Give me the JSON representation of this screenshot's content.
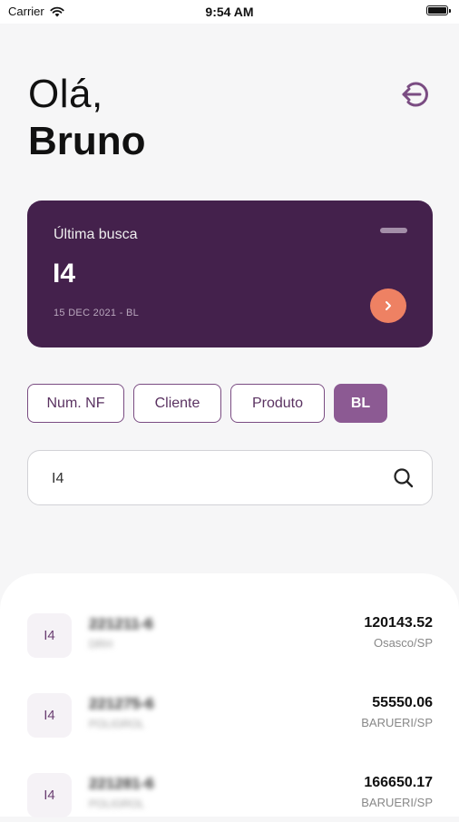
{
  "status_bar": {
    "carrier": "Carrier",
    "time": "9:54 AM"
  },
  "greeting": {
    "hello": "Olá,",
    "name": "Bruno"
  },
  "last_search": {
    "label": "Última busca",
    "value": "I4",
    "meta": "15 DEC 2021 - BL",
    "go_icon": "chevron-right"
  },
  "filters": [
    {
      "label": "Num. NF",
      "active": false
    },
    {
      "label": "Cliente",
      "active": false
    },
    {
      "label": "Produto",
      "active": false
    },
    {
      "label": "BL",
      "active": true
    }
  ],
  "search": {
    "value": "I4",
    "icon": "search"
  },
  "results": [
    {
      "badge": "I4",
      "title": "221211-6",
      "subtitle": "DRH",
      "amount": "120143.52",
      "city": "Osasco/SP"
    },
    {
      "badge": "I4",
      "title": "221275-6",
      "subtitle": "POLIGROL",
      "amount": "55550.06",
      "city": "BARUERI/SP"
    },
    {
      "badge": "I4",
      "title": "221281-6",
      "subtitle": "POLIGROL",
      "amount": "166650.17",
      "city": "BARUERI/SP"
    }
  ],
  "colors": {
    "card": "#44214c",
    "accent": "#8c5a93",
    "action": "#ee8163",
    "chip_border": "#7a4c82"
  }
}
